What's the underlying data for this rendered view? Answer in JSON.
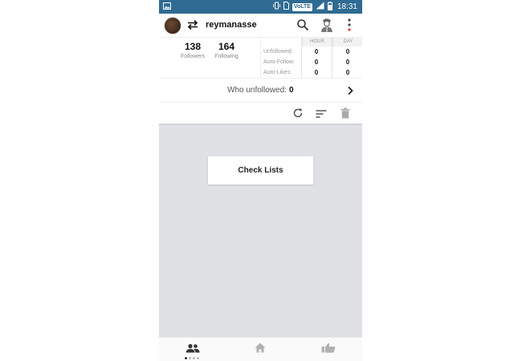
{
  "status_bar": {
    "network_badge": "VoLTE",
    "time": "18:31",
    "color": "#2f6b93"
  },
  "header": {
    "username": "reymanasse",
    "icons": [
      "swap-icon",
      "search-icon",
      "profile-icon",
      "more-vert-icon"
    ]
  },
  "stats": {
    "followers": {
      "value": "138",
      "label": "Followers"
    },
    "following": {
      "value": "164",
      "label": "Following"
    },
    "table": {
      "columns": [
        "HOUR",
        "DAY"
      ],
      "rows": [
        {
          "label": "Unfollowed:",
          "hour": "0",
          "day": "0"
        },
        {
          "label": "Auto-Follow:",
          "hour": "0",
          "day": "0"
        },
        {
          "label": "Auto-Likes:",
          "hour": "0",
          "day": "0"
        }
      ]
    }
  },
  "who_unfollowed": {
    "label": "Who unfollowed:",
    "count": "0"
  },
  "toolbar": {
    "icons": [
      "refresh-icon",
      "sort-icon",
      "delete-icon"
    ]
  },
  "content": {
    "check_lists_label": "Check Lists",
    "background": "#dfe1e5"
  },
  "bottom_nav": {
    "items": [
      "people-icon",
      "home-icon",
      "thumbs-up-icon"
    ],
    "active_index": 0,
    "page_dots": 4
  }
}
